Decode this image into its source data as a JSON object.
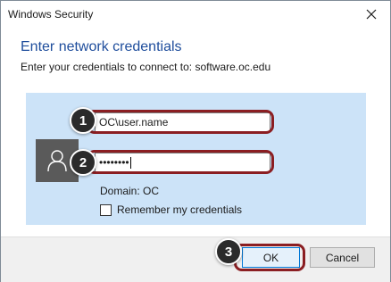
{
  "window": {
    "title": "Windows Security",
    "close_icon": "close-icon"
  },
  "dialog": {
    "heading": "Enter network credentials",
    "subheading": "Enter your credentials to connect to: software.oc.edu"
  },
  "credentials": {
    "avatar_icon": "user-icon",
    "username_value": "OC\\user.name",
    "password_value": "••••••••",
    "domain_text": "Domain: OC",
    "remember_label": "Remember my credentials",
    "remember_checked": false
  },
  "annotations": {
    "step1": "1",
    "step2": "2",
    "step3": "3",
    "highlight_color": "#8b1e22"
  },
  "buttons": {
    "ok_label": "OK",
    "cancel_label": "Cancel"
  },
  "colors": {
    "accent": "#1e4d9c",
    "panel": "#cce3f8",
    "focus": "#0078d7"
  }
}
